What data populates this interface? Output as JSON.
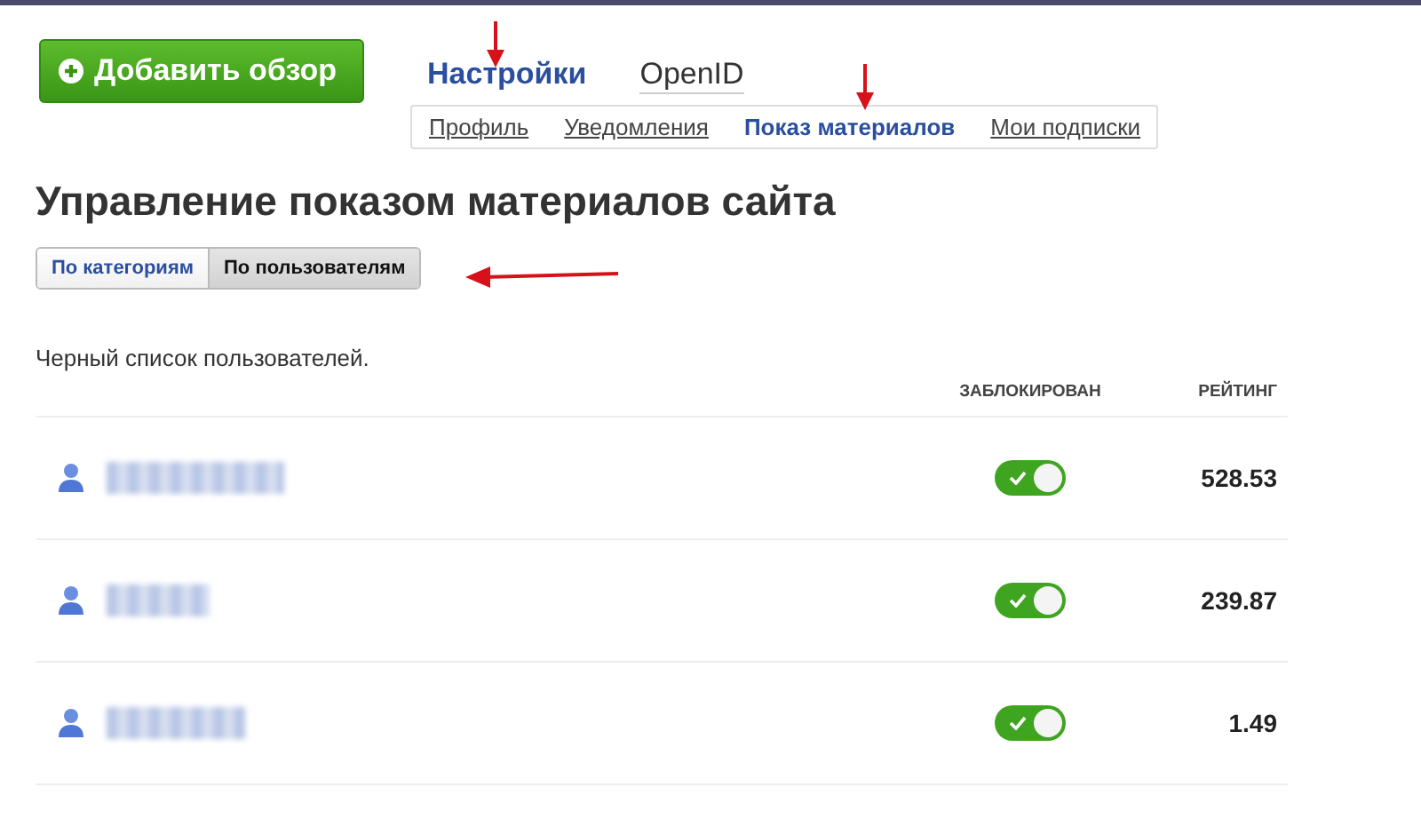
{
  "add_button": {
    "label": "Добавить обзор"
  },
  "main_tabs": [
    {
      "label": "Настройки",
      "selected": true
    },
    {
      "label": "OpenID",
      "selected": false
    }
  ],
  "sub_tabs": [
    {
      "label": "Профиль",
      "selected": false
    },
    {
      "label": "Уведомления",
      "selected": false
    },
    {
      "label": "Показ материалов",
      "selected": true
    },
    {
      "label": "Мои подписки",
      "selected": false
    }
  ],
  "heading": "Управление показом материалов сайта",
  "filter_tabs": [
    {
      "label": "По категориям",
      "selected": false
    },
    {
      "label": "По пользователям",
      "selected": true
    }
  ],
  "caption": "Черный список пользователей.",
  "columns": [
    "ЗАБЛОКИРОВАН",
    "РЕЙТИНГ"
  ],
  "rows": [
    {
      "blocked": true,
      "rating": "528.53"
    },
    {
      "blocked": true,
      "rating": "239.87"
    },
    {
      "blocked": true,
      "rating": "1.49"
    }
  ]
}
